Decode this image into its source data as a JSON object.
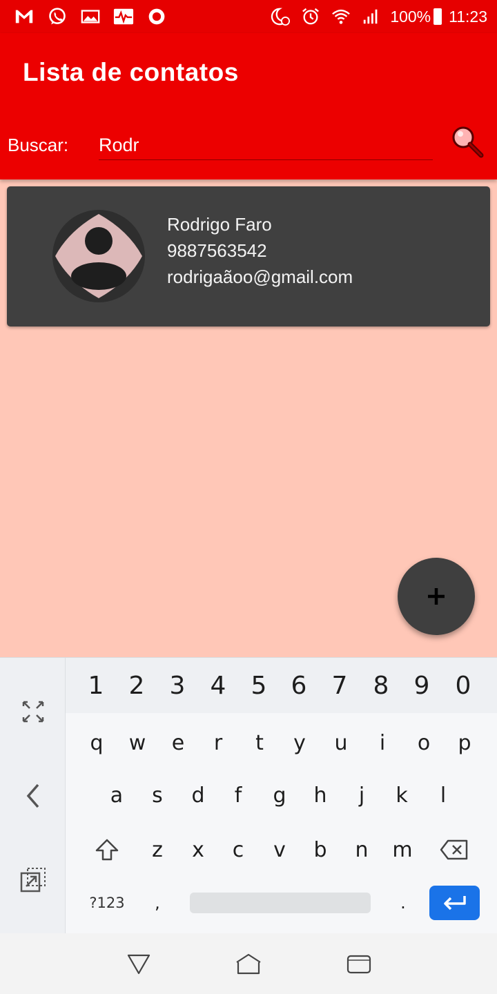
{
  "status_bar": {
    "battery": "100%",
    "time": "11:23",
    "left_icons": [
      "gmail-icon",
      "whatsapp-icon",
      "image-icon",
      "activity-icon",
      "record-icon"
    ],
    "right_icons": [
      "night-alarm-icon",
      "alarm-icon",
      "wifi-icon",
      "signal-icon",
      "battery-icon"
    ]
  },
  "app_bar": {
    "title": "Lista de contatos",
    "background": "#ec0000",
    "search": {
      "label": "Buscar:",
      "value": "Rodr",
      "icon": "search-icon"
    }
  },
  "contacts": [
    {
      "name": "Rodrigo Faro",
      "phone": "9887563542",
      "email": "rodrigaãoo@gmail.com",
      "avatar_icon": "default-avatar-icon"
    }
  ],
  "fab": {
    "icon": "plus-icon",
    "label": "+"
  },
  "keyboard": {
    "number_row": [
      "1",
      "2",
      "3",
      "4",
      "5",
      "6",
      "7",
      "8",
      "9",
      "0"
    ],
    "row1": [
      "q",
      "w",
      "e",
      "r",
      "t",
      "y",
      "u",
      "i",
      "o",
      "p"
    ],
    "row2": [
      "a",
      "s",
      "d",
      "f",
      "g",
      "h",
      "j",
      "k",
      "l"
    ],
    "row3": [
      "z",
      "x",
      "c",
      "v",
      "b",
      "n",
      "m"
    ],
    "symbols_key": "?123",
    "comma_key": ",",
    "period_key": ".",
    "side_icons": [
      "expand-icon",
      "chevron-left-icon",
      "float-keyboard-icon"
    ],
    "enter_color": "#1a73e8"
  },
  "nav_bar": {
    "icons": [
      "back-icon",
      "home-icon",
      "recents-icon"
    ]
  },
  "colors": {
    "background": "#ffc7b7",
    "status_bar": "#e60000",
    "card": "#404040",
    "fab": "#3f3f3f"
  }
}
